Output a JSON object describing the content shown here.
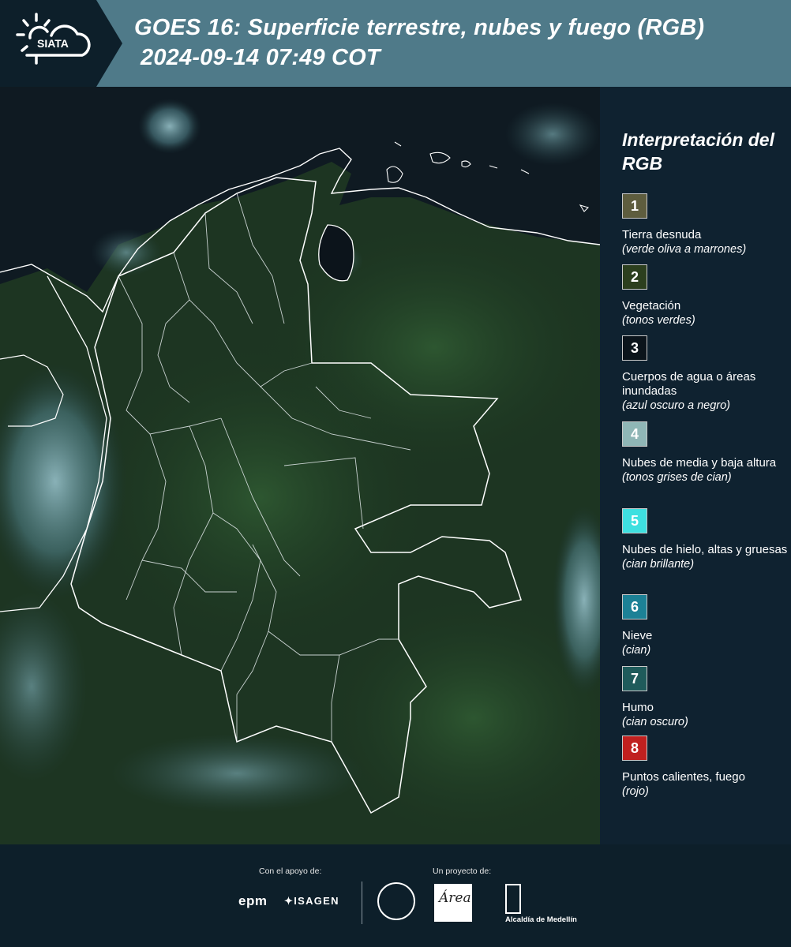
{
  "header": {
    "logo_text": "SIATA",
    "title_line1": "GOES 16: Superficie terrestre, nubes y fuego (RGB)",
    "title_line2": "2024-09-14 07:49 COT"
  },
  "legend": {
    "title": "Interpretación del RGB",
    "items": [
      {
        "num": "1",
        "label": "Tierra desnuda",
        "sub": "(verde oliva a marrones)",
        "color": "#5e5d3e"
      },
      {
        "num": "2",
        "label": "Vegetación",
        "sub": "(tonos verdes)",
        "color": "#2c3f1e"
      },
      {
        "num": "3",
        "label": "Cuerpos de agua o áreas inundadas",
        "sub": "(azul oscuro a negro)",
        "color": "#0b141b"
      },
      {
        "num": "4",
        "label": "Nubes de media y baja altura",
        "sub": "(tonos grises de cian)",
        "color": "#8fb6b6"
      },
      {
        "num": "5",
        "label": "Nubes de hielo, altas y gruesas",
        "sub": "(cian brillante)",
        "color": "#3ee0e0"
      },
      {
        "num": "6",
        "label": "Nieve",
        "sub": "(cian)",
        "color": "#1c8196"
      },
      {
        "num": "7",
        "label": "Humo",
        "sub": "(cian oscuro)",
        "color": "#1f5b5b"
      },
      {
        "num": "8",
        "label": "Puntos calientes, fuego",
        "sub": "(rojo)",
        "color": "#c0201f"
      }
    ]
  },
  "footer": {
    "support_label": "Con el apoyo de:",
    "project_label": "Un proyecto de:",
    "epm": "epm",
    "isagen": "ISAGEN",
    "area_logo_text": "Área",
    "alcaldia": "Alcaldía de Medellín"
  }
}
